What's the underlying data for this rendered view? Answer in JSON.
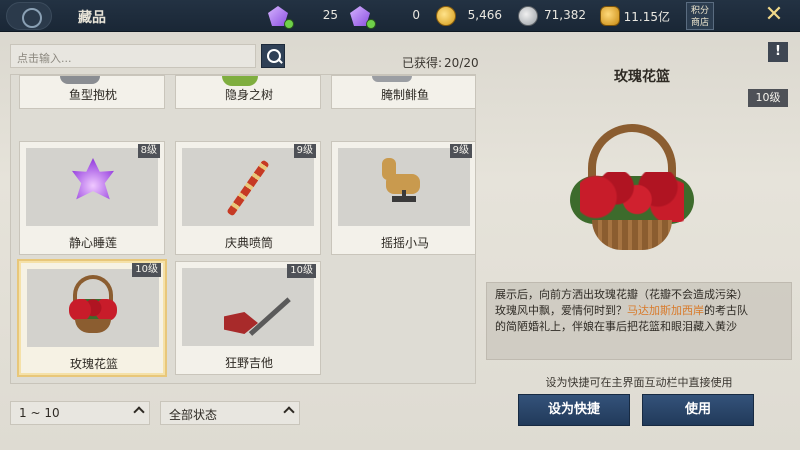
{
  "header": {
    "title": "藏品",
    "shop_label_line1": "积分",
    "shop_label_line2": "商店",
    "close_label": "✕"
  },
  "currencies": [
    {
      "name": "gem",
      "value": "25"
    },
    {
      "name": "bound-gem",
      "value": "0"
    },
    {
      "name": "gold-coin",
      "value": "5,466"
    },
    {
      "name": "silver-coin",
      "value": "71,382"
    },
    {
      "name": "gold-ingot",
      "value": "11.15亿"
    }
  ],
  "search": {
    "placeholder": "点击输入...",
    "obtained_label": "已获得:",
    "obtained_value": "20/20"
  },
  "items": [
    {
      "name": "鱼型抱枕",
      "level": ""
    },
    {
      "name": "隐身之树",
      "level": ""
    },
    {
      "name": "腌制鲱鱼",
      "level": ""
    },
    {
      "name": "静心睡莲",
      "level": "8级"
    },
    {
      "name": "庆典喷筒",
      "level": "9级"
    },
    {
      "name": "摇摇小马",
      "level": "9级"
    },
    {
      "name": "玫瑰花篮",
      "level": "10级"
    },
    {
      "name": "狂野吉他",
      "level": "10级"
    }
  ],
  "filters": {
    "range": "1 ~ 10",
    "status": "全部状态"
  },
  "detail": {
    "title": "玫瑰花篮",
    "level": "10级",
    "desc_line1": "展示后，向前方洒出玫瑰花瓣（花瓣不会造成污染）",
    "desc_line2a": "玫瑰风中飘，爱情何时到？",
    "desc_line2b": "马达加斯加西岸",
    "desc_line2c": "的考古队",
    "desc_line3": "的简陋婚礼上，伴娘在事后把花篮和眼泪藏入黄沙",
    "hint": "设为快捷可在主界面互动栏中直接使用",
    "shortcut_button": "设为快捷",
    "use_button": "使用"
  },
  "colors": {
    "accent": "#e8c77a",
    "highlight_text": "#d97a2a",
    "button": "#2a4668"
  }
}
